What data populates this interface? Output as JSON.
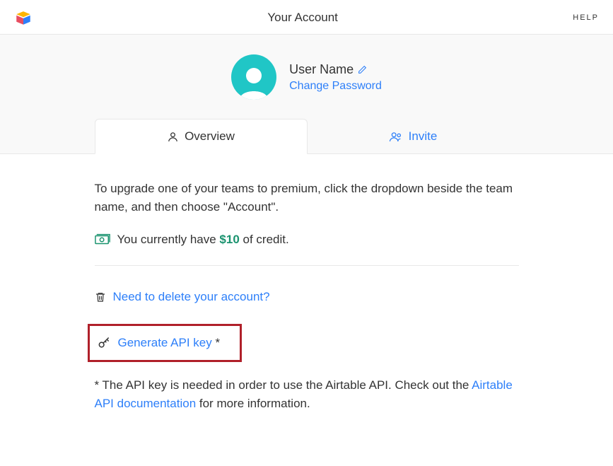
{
  "header": {
    "title": "Your Account",
    "help": "HELP"
  },
  "profile": {
    "name": "User Name",
    "change_password": "Change Password"
  },
  "tabs": {
    "overview": "Overview",
    "invite": "Invite"
  },
  "content": {
    "upgrade_text": "To upgrade one of your teams to premium, click the dropdown beside the team name, and then choose \"Account\".",
    "credit_prefix": "You currently have ",
    "credit_amount": "$10",
    "credit_suffix": " of credit.",
    "delete_link": "Need to delete your account?",
    "api_key_link": "Generate API key",
    "api_key_asterisk": " *",
    "footnote_prefix": "* The API key is needed in order to use the Airtable API. Check out the ",
    "footnote_link": "Airtable API documentation",
    "footnote_suffix": " for more information."
  }
}
